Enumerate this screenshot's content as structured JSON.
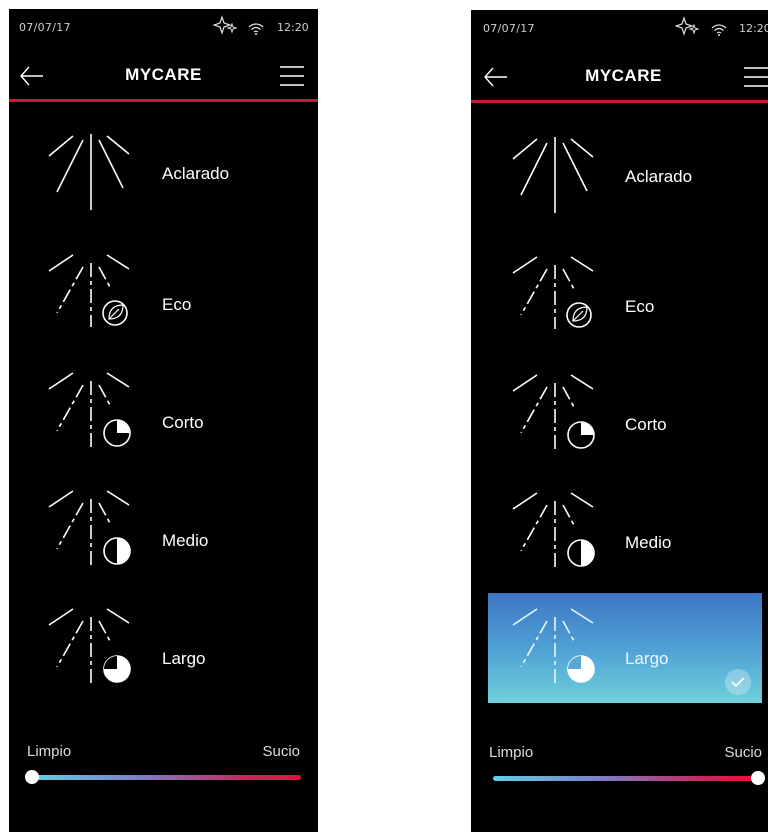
{
  "screens": [
    {
      "status": {
        "date": "07/07/17",
        "time": "12:20"
      },
      "header": {
        "title": "MYCARE"
      },
      "programs": [
        {
          "label": "Aclarado"
        },
        {
          "label": "Eco"
        },
        {
          "label": "Corto"
        },
        {
          "label": "Medio"
        },
        {
          "label": "Largo"
        }
      ],
      "selected_program": "",
      "dirt_scale": {
        "min_label": "Limpio",
        "max_label": "Sucio",
        "level": 0
      }
    },
    {
      "status": {
        "date": "07/07/17",
        "time": "12:20"
      },
      "header": {
        "title": "MYCARE"
      },
      "programs": [
        {
          "label": "Aclarado"
        },
        {
          "label": "Eco"
        },
        {
          "label": "Corto"
        },
        {
          "label": "Medio"
        },
        {
          "label": "Largo"
        }
      ],
      "selected_program": "Largo",
      "dirt_scale": {
        "min_label": "Limpio",
        "max_label": "Sucio",
        "level": 1
      }
    }
  ],
  "colors": {
    "accent_red": "#c8173b",
    "selected_blue": "#4fa0d4",
    "background": "#000000"
  },
  "icons": [
    "sparkle-icon",
    "wifi-icon",
    "back-arrow-icon",
    "hamburger-menu-icon",
    "spray-icon",
    "leaf-icon",
    "timer-icon",
    "check-icon"
  ]
}
